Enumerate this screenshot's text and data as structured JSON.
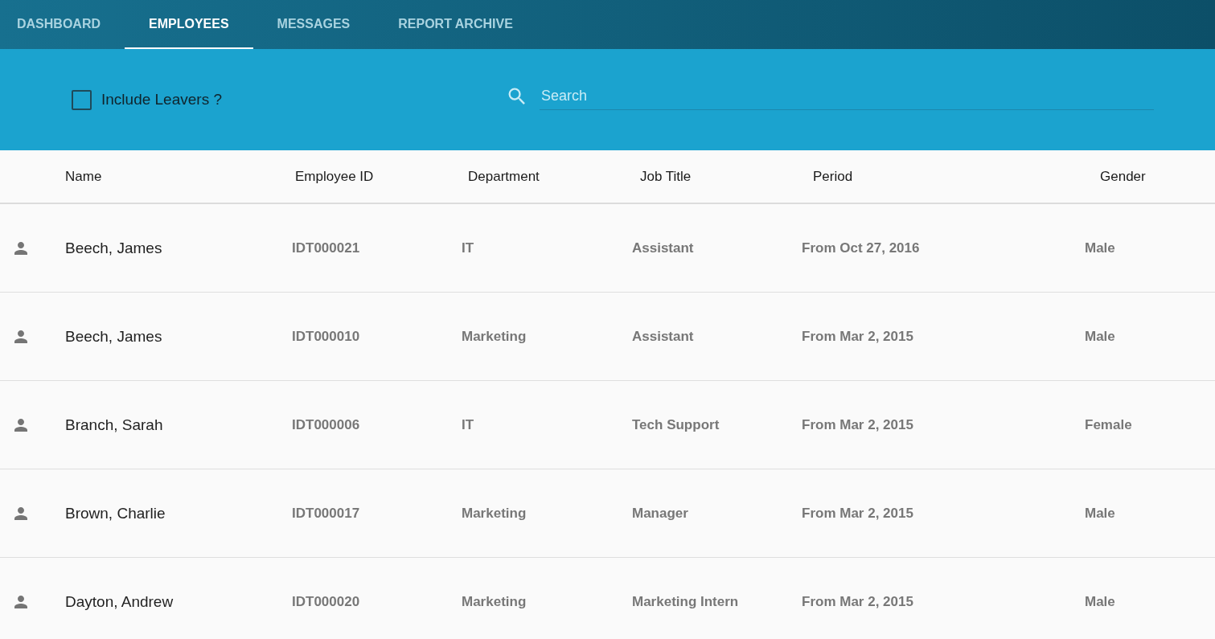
{
  "tabs": [
    {
      "label": "DASHBOARD",
      "selected": false
    },
    {
      "label": "EMPLOYEES",
      "selected": true
    },
    {
      "label": "MESSAGES",
      "selected": false
    },
    {
      "label": "REPORT ARCHIVE",
      "selected": false
    }
  ],
  "filter": {
    "label": "Include Leavers ?",
    "checked": false
  },
  "search": {
    "placeholder": "Search"
  },
  "table": {
    "columns": [
      "Name",
      "Employee ID",
      "Department",
      "Job Title",
      "Period",
      "Gender"
    ],
    "rows": [
      [
        "Beech, James",
        "IDT000021",
        "IT",
        "Assistant",
        "From Oct 27, 2016",
        "Male"
      ],
      [
        "Beech, James",
        "IDT000010",
        "Marketing",
        "Assistant",
        "From Mar 2, 2015",
        "Male"
      ],
      [
        "Branch, Sarah",
        "IDT000006",
        "IT",
        "Tech Support",
        "From Mar 2, 2015",
        "Female"
      ],
      [
        "Brown, Charlie",
        "IDT000017",
        "Marketing",
        "Manager",
        "From Mar 2, 2015",
        "Male"
      ],
      [
        "Dayton, Andrew",
        "IDT000020",
        "Marketing",
        "Marketing Intern",
        "From Mar 2, 2015",
        "Male"
      ]
    ]
  }
}
